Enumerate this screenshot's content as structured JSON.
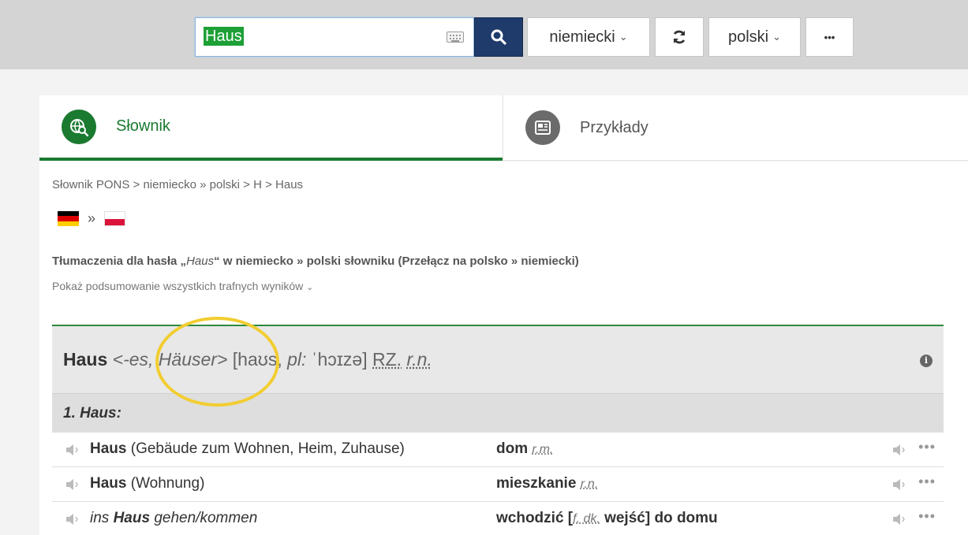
{
  "toolbar": {
    "search_value": "Haus",
    "source_lang": "niemiecki",
    "target_lang": "polski",
    "more_label": "•••"
  },
  "tabs": [
    {
      "label": "Słownik"
    },
    {
      "label": "Przykłady"
    }
  ],
  "breadcrumb": "Słownik PONS > niemiecko » polski > H > Haus",
  "flags_arrow": "»",
  "heading": {
    "prefix": "Tłumaczenia dla hasła „",
    "term": "Haus",
    "suffix": "“ w niemiecko » polski słowniku (Przełącz na polsko » niemiecki)"
  },
  "summary_link": "Pokaż podsumowanie wszystkich trafnych wyników",
  "entry": {
    "headword": "Haus",
    "forms": "<-es, Häuser>",
    "phonetics": "[haʊs, ",
    "plural_label": "pl:",
    "plural_phon": " ˈhɔɪzə]",
    "pos": "RZ.",
    "gender": "r.n.",
    "sense_label": "1. Haus:",
    "rows": [
      {
        "src_bold": "Haus",
        "src_rest": " (Gebäude zum Wohnen, Heim, Zuhause)",
        "tgt": "dom",
        "tgt_gram": "r.m."
      },
      {
        "src_bold": "Haus",
        "src_rest": " (Wohnung)",
        "tgt": "mieszkanie",
        "tgt_gram": "r.n."
      },
      {
        "src_pre": "ins ",
        "src_bold": "Haus",
        "src_rest": " gehen/kommen",
        "tgt": "wchodzić [",
        "tgt_gram": "f. dk.",
        "tgt_rest": " wejść] do domu"
      }
    ]
  },
  "colors": {
    "brand_green": "#1a7a30",
    "search_button": "#1f3b6b",
    "highlight": "#f2cd31"
  },
  "icons": [
    "keyboard-icon",
    "search-icon",
    "swap-languages-icon",
    "more-icon",
    "dictionary-globe-icon",
    "examples-newspaper-icon",
    "info-icon",
    "speaker-icon",
    "flag-de-icon",
    "flag-pl-icon"
  ]
}
